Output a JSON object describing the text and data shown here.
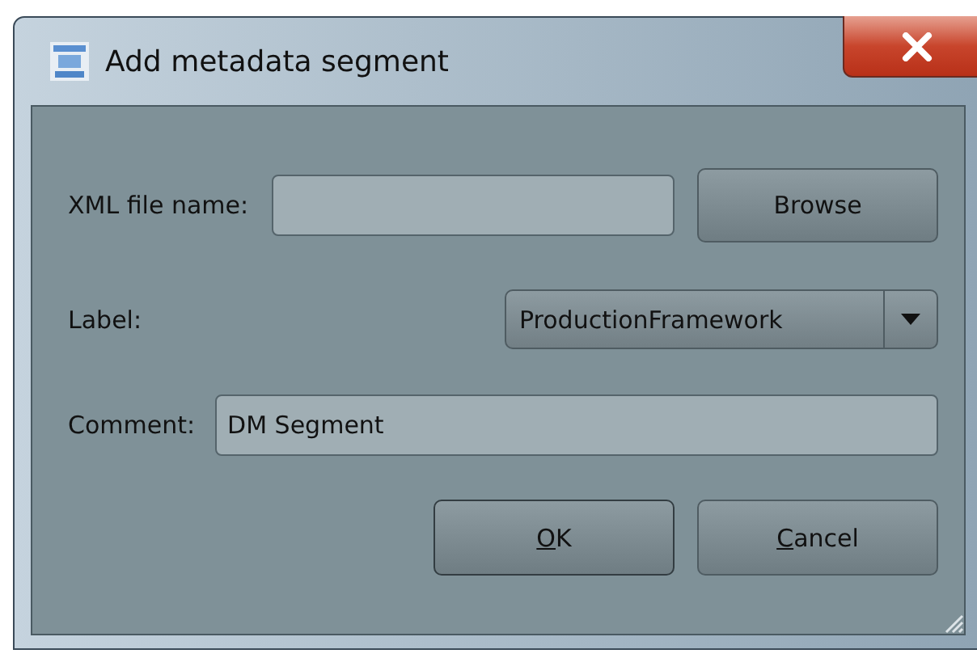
{
  "window": {
    "title": "Add metadata segment"
  },
  "xml_file": {
    "label": "XML file name:"
  },
  "browse_button": "Browse",
  "label_field": {
    "label": "Label:",
    "value": "ProductionFramework"
  },
  "comment_field": {
    "label": "Comment:",
    "value": "DM Segment"
  },
  "buttons": [
    {
      "mnemonic": "O",
      "rest": "K"
    },
    {
      "mnemonic": "C",
      "rest": "ancel"
    }
  ]
}
